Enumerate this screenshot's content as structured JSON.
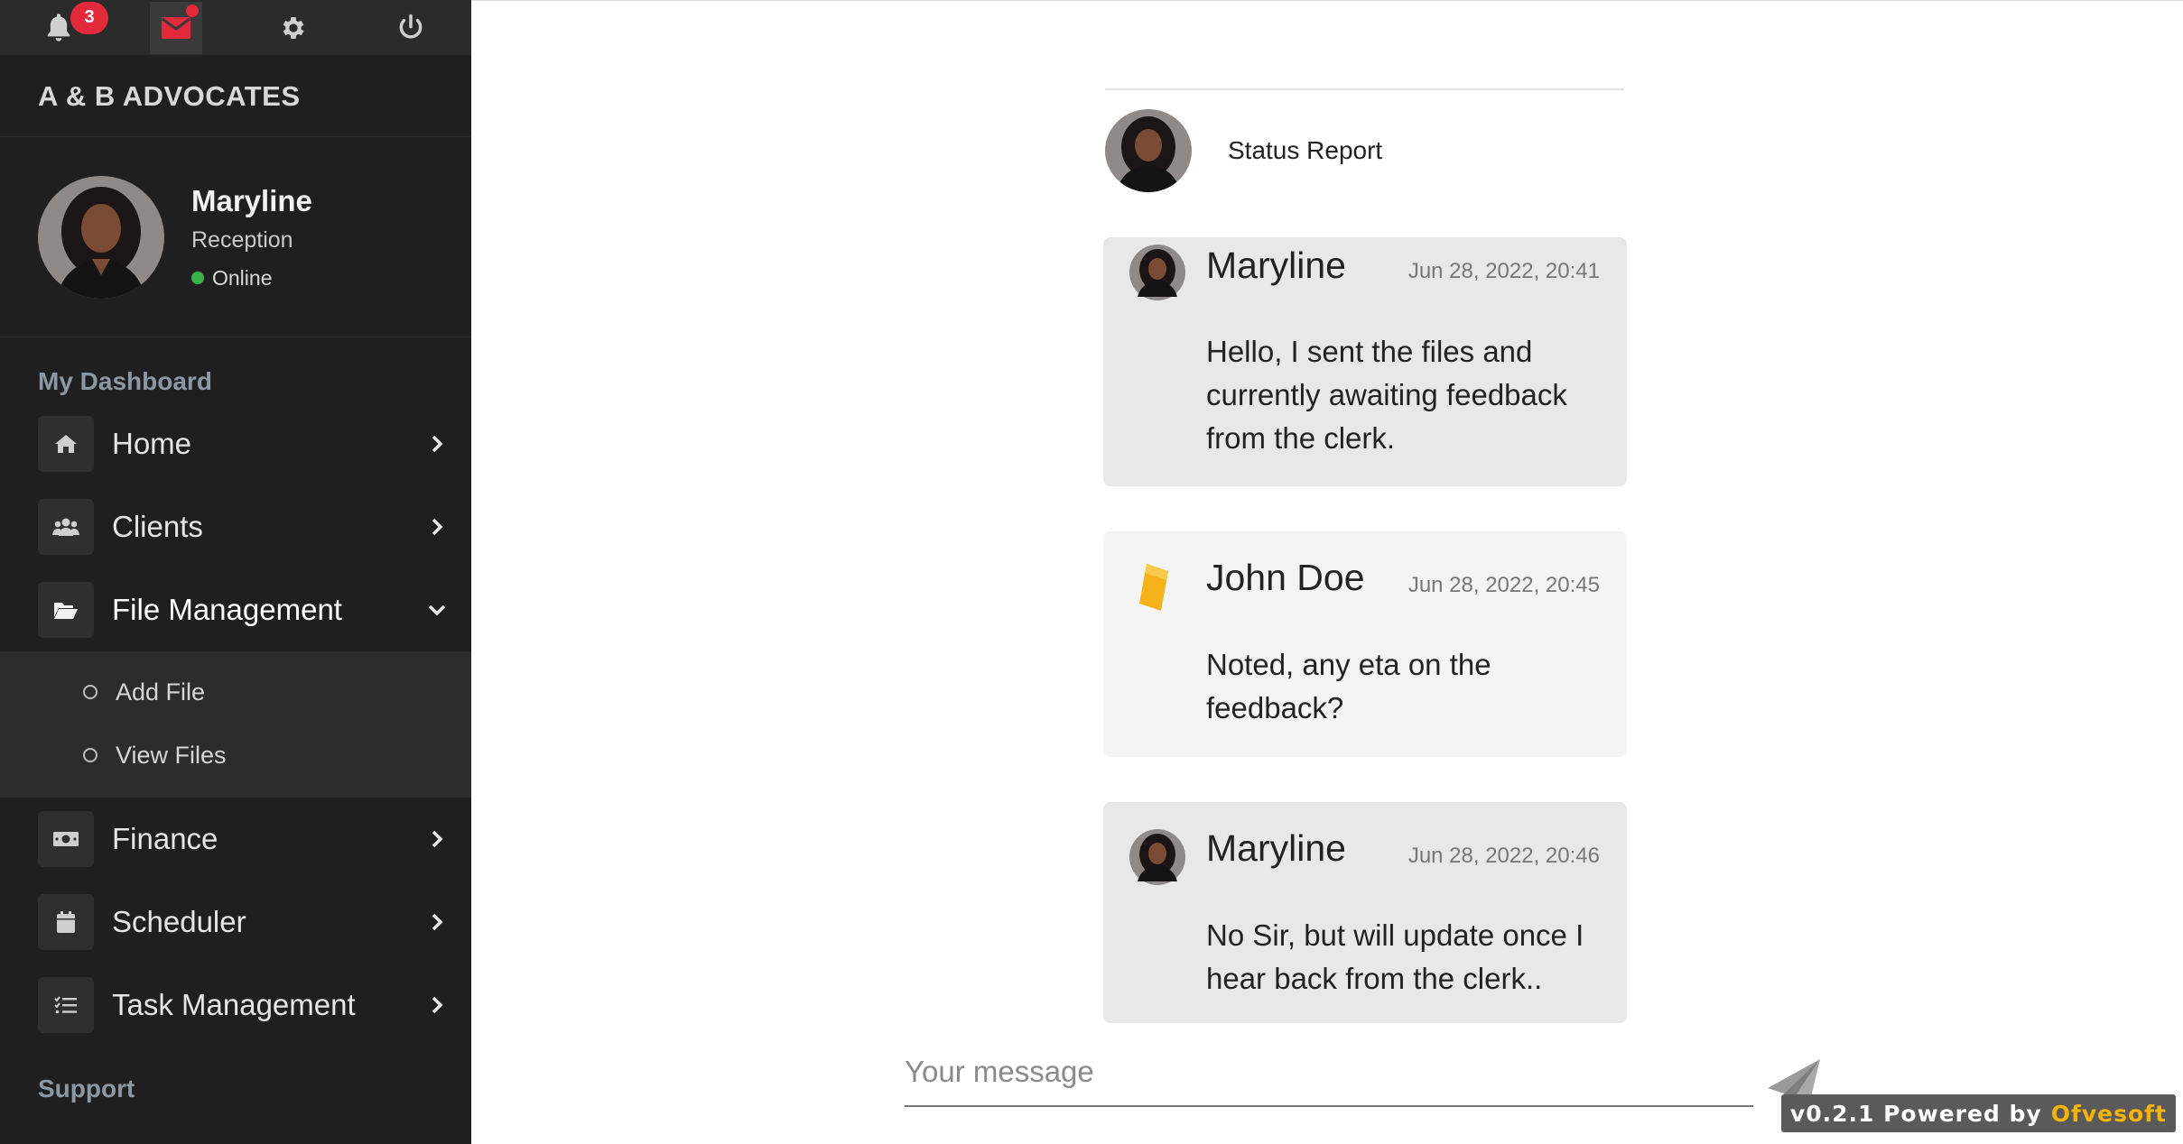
{
  "topbar": {
    "notification_count": "3"
  },
  "brand": "A & B ADVOCATES",
  "user": {
    "name": "Maryline",
    "role": "Reception",
    "status": "Online"
  },
  "nav": {
    "dashboard_header": "My Dashboard",
    "support_header": "Support",
    "items": [
      {
        "label": "Home",
        "icon": "home-icon"
      },
      {
        "label": "Clients",
        "icon": "users-icon"
      },
      {
        "label": "File Management",
        "icon": "folder-open-icon",
        "expanded": true
      },
      {
        "label": "Finance",
        "icon": "money-icon"
      },
      {
        "label": "Scheduler",
        "icon": "calendar-icon"
      },
      {
        "label": "Task Management",
        "icon": "tasks-icon"
      }
    ],
    "file_sub": [
      {
        "label": "Add File"
      },
      {
        "label": "View Files"
      }
    ]
  },
  "chat": {
    "title": "Status Report",
    "messages": [
      {
        "author": "Maryline",
        "time": "Jun 28, 2022, 20:41",
        "text": "Hello, I sent the files and currently awaiting feedback from the clerk."
      },
      {
        "author": "John Doe",
        "time": "Jun 28, 2022, 20:45",
        "text": "Noted, any eta on the feedback?"
      },
      {
        "author": "Maryline",
        "time": "Jun 28, 2022, 20:46",
        "text": "No Sir, but will update once I hear back from the clerk.."
      }
    ],
    "input_placeholder": "Your message"
  },
  "footer": {
    "version_text": "v0.2.1 Powered by",
    "brand": "Ofvesoft"
  },
  "colors": {
    "sidebar_bg": "#1f1f1f",
    "accent_red": "#e22a3b",
    "online_green": "#3cb34a",
    "footer_brand": "#f6b400"
  }
}
